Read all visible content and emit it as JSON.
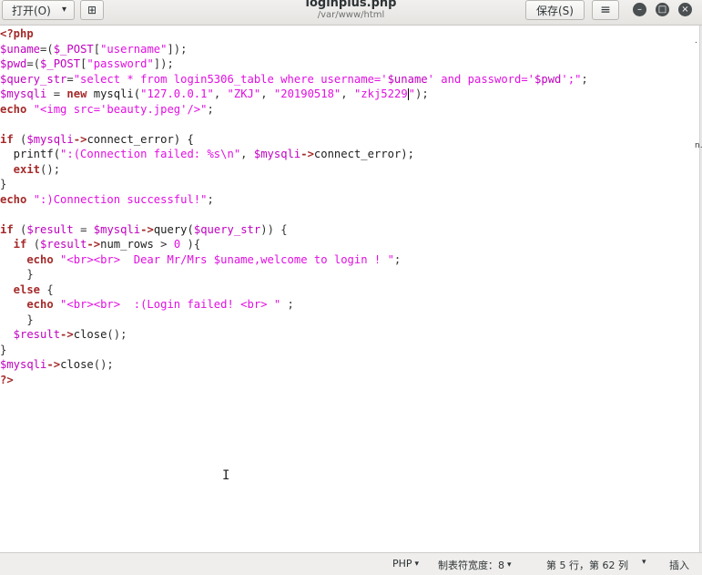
{
  "header": {
    "open_label": "打开(O)",
    "title": "loginplus.php",
    "subtitle": "/var/www/html",
    "save_label": "保存(S)"
  },
  "icons": {
    "open_caret": "▾",
    "new_doc": "⊞",
    "menu": "≡",
    "minimize": "–",
    "maximize": "□",
    "close": "×"
  },
  "code_lines": [
    [
      {
        "t": "<?php",
        "c": "k"
      }
    ],
    [
      {
        "t": "$uname",
        "c": "v"
      },
      {
        "t": "=(",
        "c": "p"
      },
      {
        "t": "$_POST",
        "c": "v"
      },
      {
        "t": "[",
        "c": "p"
      },
      {
        "t": "\"username\"",
        "c": "s"
      },
      {
        "t": "]);",
        "c": "p"
      }
    ],
    [
      {
        "t": "$pwd",
        "c": "v"
      },
      {
        "t": "=(",
        "c": "p"
      },
      {
        "t": "$_POST",
        "c": "v"
      },
      {
        "t": "[",
        "c": "p"
      },
      {
        "t": "\"password\"",
        "c": "s"
      },
      {
        "t": "]);",
        "c": "p"
      }
    ],
    [
      {
        "t": "$query_str",
        "c": "v"
      },
      {
        "t": "=",
        "c": "p"
      },
      {
        "t": "\"select * from login5306_table where username='",
        "c": "s"
      },
      {
        "t": "$uname",
        "c": "v"
      },
      {
        "t": "' and password='",
        "c": "s"
      },
      {
        "t": "$pwd",
        "c": "v"
      },
      {
        "t": "';\"",
        "c": "s"
      },
      {
        "t": ";",
        "c": "p"
      }
    ],
    [
      {
        "t": "$mysqli",
        "c": "v"
      },
      {
        "t": " = ",
        "c": "p"
      },
      {
        "t": "new",
        "c": "k"
      },
      {
        "t": " mysqli(",
        "c": "f"
      },
      {
        "t": "\"127.0.0.1\"",
        "c": "s"
      },
      {
        "t": ", ",
        "c": "p"
      },
      {
        "t": "\"ZKJ\"",
        "c": "s"
      },
      {
        "t": ", ",
        "c": "p"
      },
      {
        "t": "\"20190518\"",
        "c": "s"
      },
      {
        "t": ", ",
        "c": "p"
      },
      {
        "t": "\"zkj5229",
        "c": "s"
      },
      {
        "t": "CURSOR",
        "c": "cursor"
      },
      {
        "t": "\"",
        "c": "s"
      },
      {
        "t": ");",
        "c": "p"
      }
    ],
    [
      {
        "t": "echo",
        "c": "k"
      },
      {
        "t": " ",
        "c": "p"
      },
      {
        "t": "\"<img src='beauty.jpeg'/>\"",
        "c": "s"
      },
      {
        "t": ";",
        "c": "p"
      }
    ],
    [],
    [
      {
        "t": "if",
        "c": "k"
      },
      {
        "t": " (",
        "c": "p"
      },
      {
        "t": "$mysqli",
        "c": "v"
      },
      {
        "t": "->",
        "c": "k"
      },
      {
        "t": "connect_error) {",
        "c": "f"
      }
    ],
    [
      {
        "t": "  printf(",
        "c": "f"
      },
      {
        "t": "\":(Connection failed: %s\\n\"",
        "c": "s"
      },
      {
        "t": ", ",
        "c": "p"
      },
      {
        "t": "$mysqli",
        "c": "v"
      },
      {
        "t": "->",
        "c": "k"
      },
      {
        "t": "connect_error);",
        "c": "f"
      }
    ],
    [
      {
        "t": "  exit",
        "c": "k"
      },
      {
        "t": "();",
        "c": "p"
      }
    ],
    [
      {
        "t": "}",
        "c": "p"
      }
    ],
    [
      {
        "t": "echo",
        "c": "k"
      },
      {
        "t": " ",
        "c": "p"
      },
      {
        "t": "\":)Connection successful!\"",
        "c": "s"
      },
      {
        "t": ";",
        "c": "p"
      }
    ],
    [],
    [
      {
        "t": "if",
        "c": "k"
      },
      {
        "t": " (",
        "c": "p"
      },
      {
        "t": "$result",
        "c": "v"
      },
      {
        "t": " = ",
        "c": "p"
      },
      {
        "t": "$mysqli",
        "c": "v"
      },
      {
        "t": "->",
        "c": "k"
      },
      {
        "t": "query(",
        "c": "f"
      },
      {
        "t": "$query_str",
        "c": "v"
      },
      {
        "t": ")) {",
        "c": "p"
      }
    ],
    [
      {
        "t": "  if",
        "c": "k"
      },
      {
        "t": " (",
        "c": "p"
      },
      {
        "t": "$result",
        "c": "v"
      },
      {
        "t": "->",
        "c": "k"
      },
      {
        "t": "num_rows",
        "c": "f"
      },
      {
        "t": " > ",
        "c": "p"
      },
      {
        "t": "0",
        "c": "s"
      },
      {
        "t": " ){",
        "c": "p"
      }
    ],
    [
      {
        "t": "    echo",
        "c": "k"
      },
      {
        "t": " ",
        "c": "p"
      },
      {
        "t": "\"<br><br>  Dear Mr/Mrs $uname,welcome to login ! \"",
        "c": "s"
      },
      {
        "t": ";",
        "c": "p"
      }
    ],
    [
      {
        "t": "    }",
        "c": "p"
      }
    ],
    [
      {
        "t": "  else",
        "c": "k"
      },
      {
        "t": " {",
        "c": "p"
      }
    ],
    [
      {
        "t": "    echo",
        "c": "k"
      },
      {
        "t": " ",
        "c": "p"
      },
      {
        "t": "\"<br><br>  :(Login failed! <br> \"",
        "c": "s"
      },
      {
        "t": " ;",
        "c": "p"
      }
    ],
    [
      {
        "t": "    }",
        "c": "p"
      }
    ],
    [
      {
        "t": "  $result",
        "c": "v"
      },
      {
        "t": "->",
        "c": "k"
      },
      {
        "t": "close",
        "c": "f"
      },
      {
        "t": "();",
        "c": "p"
      }
    ],
    [
      {
        "t": "}",
        "c": "p"
      }
    ],
    [
      {
        "t": "$mysqli",
        "c": "v"
      },
      {
        "t": "->",
        "c": "k"
      },
      {
        "t": "close",
        "c": "f"
      },
      {
        "t": "();",
        "c": "p"
      }
    ],
    [
      {
        "t": "?>",
        "c": "k"
      }
    ]
  ],
  "edge_marks": [
    "n.",
    "."
  ],
  "statusbar": {
    "language": "PHP",
    "tab_width": "制表符宽度：8",
    "position": "第 5 行，第 62 列",
    "mode": "插入",
    "caret": "▾"
  },
  "colors": {
    "keyword": "#a52a2a",
    "variable": "#c000c0",
    "string": "#e010e0"
  }
}
